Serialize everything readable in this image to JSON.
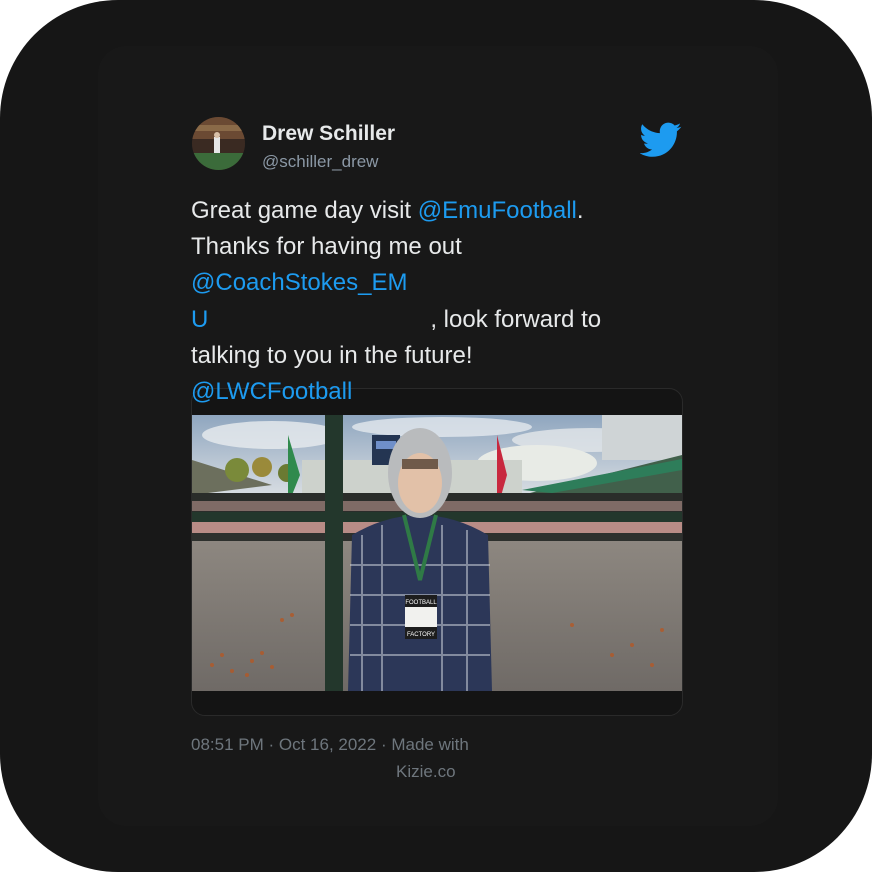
{
  "author": {
    "name": "Drew Schiller",
    "handle": "@schiller_drew"
  },
  "tweet": {
    "line1_text": "Great game day visit ",
    "line1_mention": "@EmuFootball",
    "line1_end": ".",
    "line2_text": "Thanks for having me out",
    "line3_mention": "@CoachStokes_EM",
    "line4_mention": "U",
    "line4_text": ", look forward to",
    "line5_text": "talking to you in the future!",
    "line6_mention": "@LWCFootball"
  },
  "media": {
    "badge_line1": "FOOTBALL",
    "badge_line2": "FACTORY"
  },
  "footer": {
    "timestamp": "08:51 PM · Oct 16, 2022 · Made with",
    "made_with": "Kizie.co"
  },
  "colors": {
    "frame_bg": "#161616",
    "text": "#e7e9ea",
    "mention": "#1d9bf0",
    "muted": "#6e767d",
    "twitter_blue": "#1d9bf0"
  },
  "icons": {
    "brand": "twitter-bird-icon"
  }
}
